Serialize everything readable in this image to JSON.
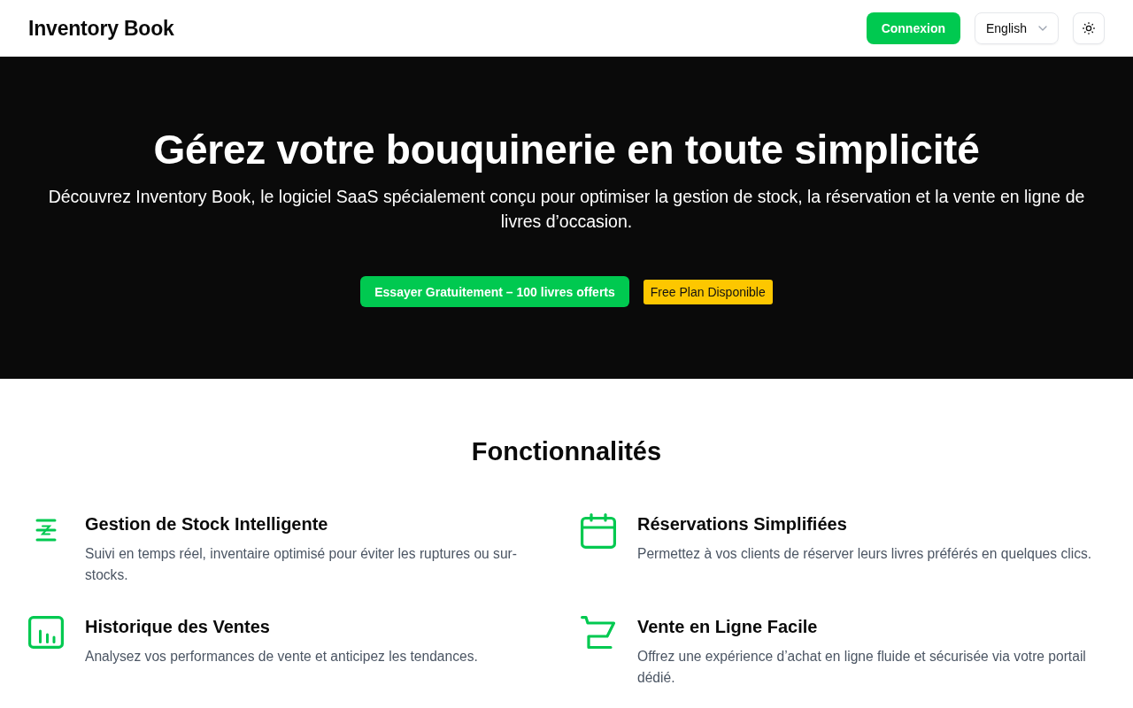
{
  "header": {
    "brand": "Inventory Book",
    "login_button": "Connexion",
    "language_select": {
      "value": "English"
    }
  },
  "hero": {
    "title": "Gérez votre bouquinerie en toute simplicité",
    "subtitle": "Découvrez Inventory Book, le logiciel SaaS spécialement conçu pour optimiser la gestion de stock, la réservation et la vente en ligne de livres d’occasion.",
    "cta_button": "Essayer Gratuitement – 100 livres offerts",
    "badge": "Free Plan Disponible"
  },
  "features": {
    "heading": "Fonctionnalités",
    "items": [
      {
        "kind": "stock",
        "title": "Gestion de Stock Intelligente",
        "description": "Suivi en temps réel, inventaire optimisé pour éviter les ruptures ou sur-stocks."
      },
      {
        "kind": "calendar",
        "title": "Réservations Simplifiées",
        "description": "Permettez à vos clients de réserver leurs livres préférés en quelques clics."
      },
      {
        "kind": "chart",
        "title": "Historique des Ventes",
        "description": "Analysez vos performances de vente et anticipez les tendances."
      },
      {
        "kind": "cart",
        "title": "Vente en Ligne Facile",
        "description": "Offrez une expérience d’achat en ligne fluide et sécurisée via votre portail dédié."
      }
    ]
  }
}
